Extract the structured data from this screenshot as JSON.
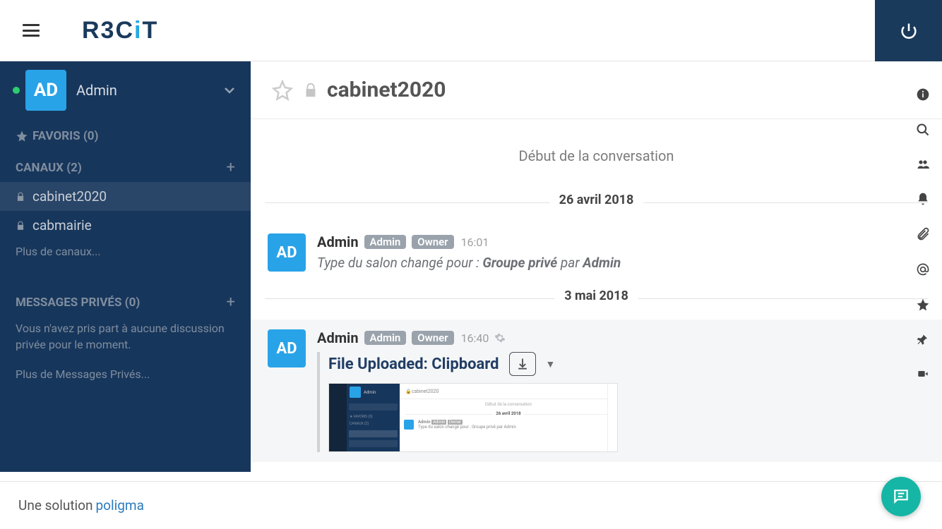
{
  "topbar": {
    "logo_main": "R3C",
    "logo_i": "i",
    "logo_t": "T"
  },
  "sidebar": {
    "user": {
      "avatar": "AD",
      "name": "Admin"
    },
    "favoris_label": "FAVORIS (0)",
    "canaux_label": "CANAUX (2)",
    "channels": [
      {
        "name": "cabinet2020",
        "active": true
      },
      {
        "name": "cabmairie",
        "active": false
      }
    ],
    "more_channels": "Plus de canaux...",
    "dm_label": "MESSAGES PRIVÉS (0)",
    "dm_empty": "Vous n'avez pris part à aucune discussion privée pour le moment.",
    "more_dm": "Plus de Messages Privés..."
  },
  "convo": {
    "title": "cabinet2020",
    "begin": "Début de la conversation",
    "dates": [
      "26 avril 2018",
      "3 mai 2018"
    ],
    "messages": [
      {
        "avatar": "AD",
        "user": "Admin",
        "tags": [
          "Admin",
          "Owner"
        ],
        "time": "16:01",
        "text_prefix": "Type du salon changé pour : ",
        "text_bold": "Groupe privé",
        "text_mid": " par ",
        "text_bold2": "Admin"
      },
      {
        "avatar": "AD",
        "user": "Admin",
        "tags": [
          "Admin",
          "Owner"
        ],
        "time": "16:40",
        "file_title": "File Uploaded: Clipboard"
      }
    ],
    "preview": {
      "title": "cabinet2020",
      "begin": "Début de la conversation",
      "date": "26 avril 2018",
      "user": "Admin",
      "msg": "Type du salon changé pour :  Groupe privé par Admin"
    }
  },
  "footer": {
    "text": "Une solution",
    "link": "poligma"
  }
}
